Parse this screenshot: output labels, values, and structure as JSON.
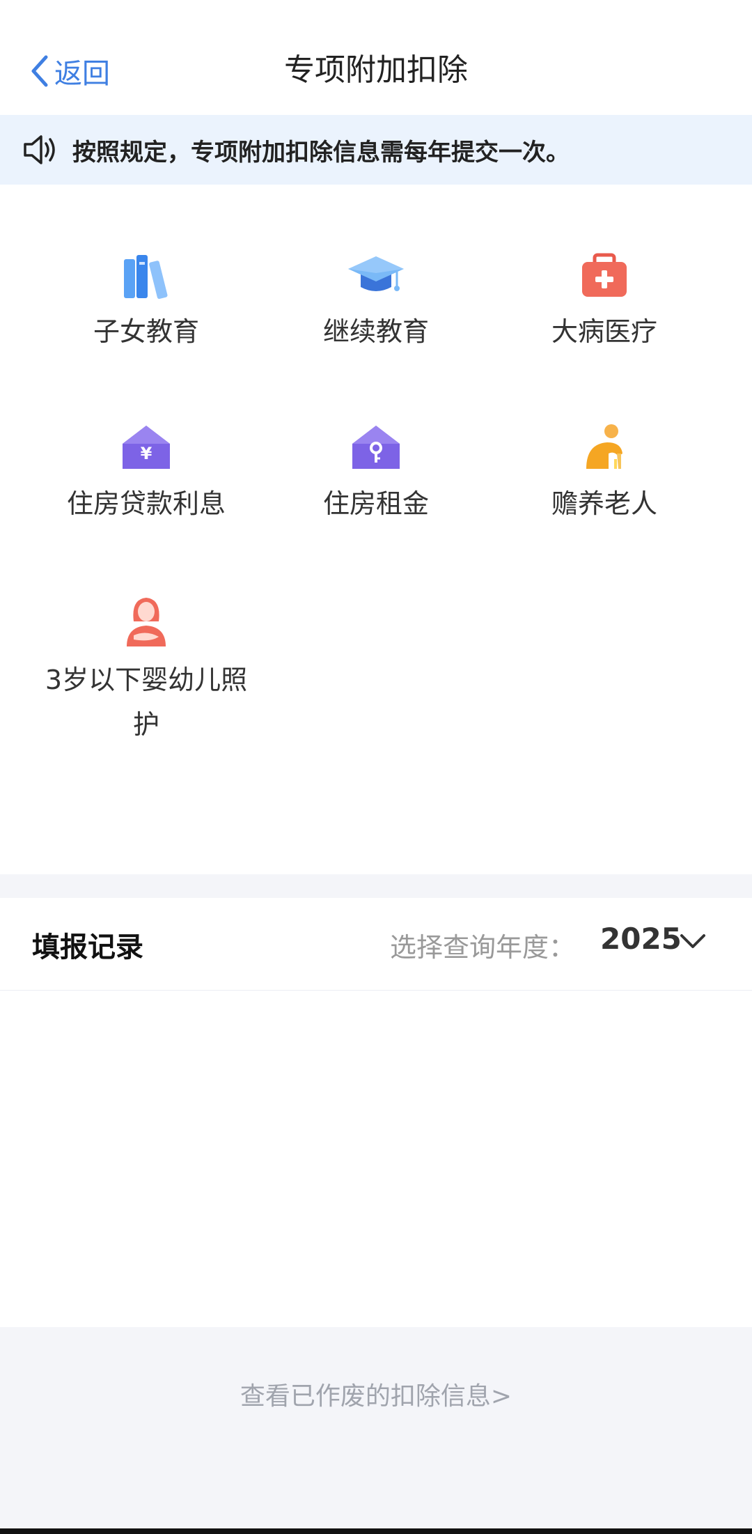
{
  "header": {
    "back_label": "返回",
    "title": "专项附加扣除"
  },
  "notice": {
    "text": "按照规定，专项附加扣除信息需每年提交一次。"
  },
  "categories": [
    {
      "label": "子女教育",
      "icon": "books-icon"
    },
    {
      "label": "继续教育",
      "icon": "graduation-cap-icon"
    },
    {
      "label": "大病医疗",
      "icon": "medical-kit-icon"
    },
    {
      "label": "住房贷款利息",
      "icon": "house-yen-icon"
    },
    {
      "label": "住房租金",
      "icon": "house-key-icon"
    },
    {
      "label": "赡养老人",
      "icon": "elderly-person-icon"
    },
    {
      "label": "3岁以下婴幼儿照护",
      "icon": "mother-baby-icon"
    }
  ],
  "records": {
    "title": "填报记录",
    "year_label": "选择查询年度：",
    "year_value": "2025"
  },
  "footer": {
    "link": "查看已作废的扣除信息>"
  },
  "colors": {
    "accent": "#3f7fe2",
    "notice_bg": "#ebf3fd",
    "band_bg": "#f4f5f9"
  }
}
